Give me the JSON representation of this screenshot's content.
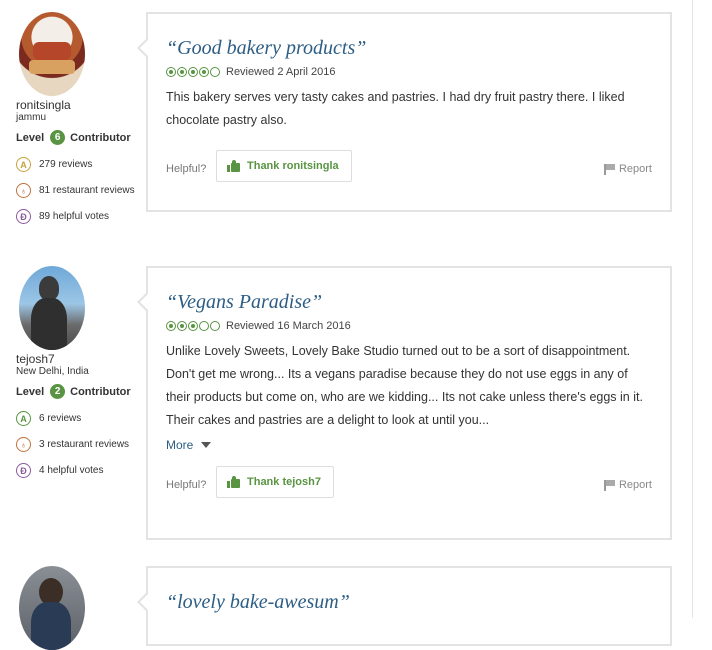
{
  "reviews": [
    {
      "user": {
        "name": "ronitsingla",
        "location": "jammu",
        "level_label": "Level",
        "level": "6",
        "contributor_label": "Contributor",
        "stats": [
          "279 reviews",
          "81 restaurant reviews",
          "89 helpful votes"
        ]
      },
      "title": "“Good bakery products”",
      "rating": 4,
      "date": "Reviewed 2 April 2016",
      "text": "This bakery serves very tasty cakes and pastries. I had dry fruit pastry there. I liked chocolate pastry also.",
      "helpful_label": "Helpful?",
      "thank_label": "Thank ronitsingla",
      "report_label": "Report"
    },
    {
      "user": {
        "name": "tejosh7",
        "location": "New Delhi, India",
        "level_label": "Level",
        "level": "2",
        "contributor_label": "Contributor",
        "stats": [
          "6 reviews",
          "3 restaurant reviews",
          "4 helpful votes"
        ]
      },
      "title": "“Vegans Paradise”",
      "rating": 3,
      "date": "Reviewed 16 March 2016",
      "text": "Unlike Lovely Sweets, Lovely Bake Studio turned out to be a sort of disappointment. Don't get me wrong... Its a vegans paradise because they do not use eggs in any of their products but come on, who are we kidding... Its not cake unless there's eggs in it. Their cakes and pastries are a delight to look at until you...",
      "more_label": "More",
      "helpful_label": "Helpful?",
      "thank_label": "Thank tejosh7",
      "report_label": "Report"
    },
    {
      "title": "“lovely bake-awesum”"
    }
  ],
  "colors": {
    "accent_green": "#589442",
    "title_blue": "#2c5d84"
  },
  "icons": [
    "review-count-icon",
    "restaurant-review-icon",
    "helpful-votes-icon",
    "thumbs-up-icon",
    "flag-icon",
    "chevron-down-icon"
  ]
}
